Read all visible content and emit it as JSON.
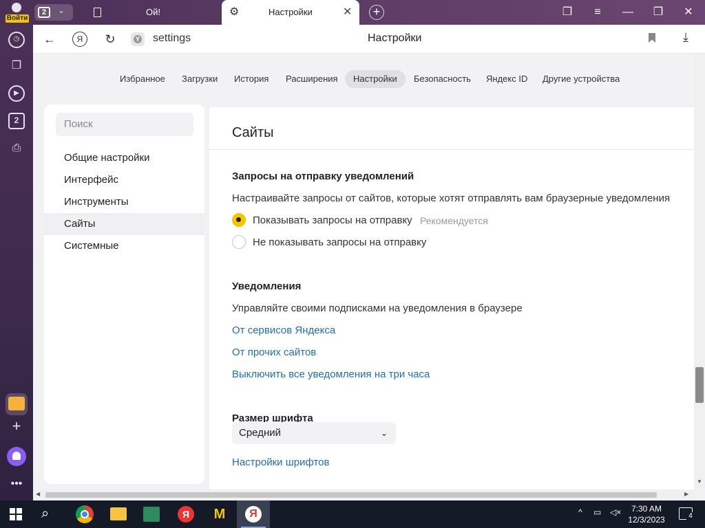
{
  "titlebar": {
    "login_label": "Войти",
    "tab_count": "2",
    "tabs": [
      {
        "title": "Ой!"
      },
      {
        "title": "Настройки"
      }
    ],
    "icons": [
      "user-icon",
      "chevron-down-icon",
      "document-icon",
      "gear-icon",
      "close-icon",
      "plus-icon",
      "collections-icon",
      "menu-icon",
      "minimize-icon",
      "restore-icon",
      "close-window-icon"
    ]
  },
  "navbar": {
    "yandex_letter": "Я",
    "url": "settings",
    "page_title": "Настройки"
  },
  "top_nav": {
    "items": [
      "Избранное",
      "Загрузки",
      "История",
      "Расширения",
      "Настройки",
      "Безопасность",
      "Яндекс ID",
      "Другие устройства"
    ],
    "active": "Настройки"
  },
  "sidebar": {
    "search_placeholder": "Поиск",
    "items": [
      "Общие настройки",
      "Интерфейс",
      "Инструменты",
      "Сайты",
      "Системные"
    ],
    "active": "Сайты"
  },
  "main": {
    "section_title": "Сайты",
    "notif_requests": {
      "heading": "Запросы на отправку уведомлений",
      "description": "Настраивайте запросы от сайтов, которые хотят отправлять вам браузерные уведомления",
      "options": [
        {
          "label": "Показывать запросы на отправку",
          "note": "Рекомендуется",
          "selected": true
        },
        {
          "label": "Не показывать запросы на отправку",
          "note": "",
          "selected": false
        }
      ]
    },
    "notifications": {
      "heading": "Уведомления",
      "description": "Управляйте своими подписками на уведомления в браузере",
      "links": [
        "От сервисов Яндекса",
        "От прочих сайтов",
        "Выключить все уведомления на три часа"
      ]
    },
    "font_size": {
      "heading": "Размер шрифта",
      "selected": "Средний",
      "link": "Настройки шрифтов"
    }
  },
  "taskbar": {
    "time": "7:30 AM",
    "date": "12/3/2023",
    "notification_count": "4",
    "yandex_letter": "Я"
  },
  "colors": {
    "accent_yellow": "#f5c500",
    "link_blue": "#1c6fb5",
    "titlebar_purple": "#4a2f57"
  }
}
